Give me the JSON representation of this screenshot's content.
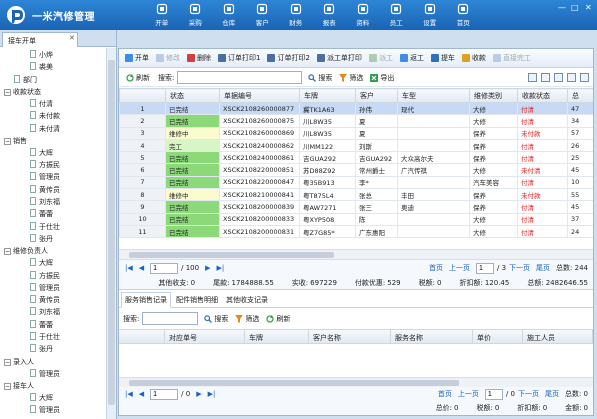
{
  "app": {
    "title": "一米汽修管理"
  },
  "nav": [
    {
      "label": "开单",
      "icon": "cart-icon"
    },
    {
      "label": "采购",
      "icon": "purchase-icon"
    },
    {
      "label": "仓库",
      "icon": "warehouse-icon"
    },
    {
      "label": "客户",
      "icon": "customer-icon"
    },
    {
      "label": "财务",
      "icon": "finance-icon"
    },
    {
      "label": "报表",
      "icon": "report-icon"
    },
    {
      "label": "资料",
      "icon": "data-icon"
    },
    {
      "label": "员工",
      "icon": "staff-icon"
    },
    {
      "label": "设置",
      "icon": "settings-icon"
    },
    {
      "label": "首页",
      "icon": "home-icon"
    }
  ],
  "window_controls": {
    "minimize": "—",
    "maximize": "□",
    "close": "✕"
  },
  "left_tab": {
    "label": "接车开单",
    "close": "✕"
  },
  "tree": [
    {
      "label": "小烨",
      "level": 2
    },
    {
      "label": "裘美",
      "level": 2
    },
    {
      "label": "部门",
      "level": 1,
      "leaf": true
    },
    {
      "label": "收款状态",
      "level": 0,
      "toggle": "⊟"
    },
    {
      "label": "付清",
      "level": 1
    },
    {
      "label": "未付款",
      "level": 1
    },
    {
      "label": "未付清",
      "level": 1
    },
    {
      "label": "销售",
      "level": 0,
      "toggle": "⊟"
    },
    {
      "label": "大辉",
      "level": 1
    },
    {
      "label": "方振民",
      "level": 1
    },
    {
      "label": "管理员",
      "level": 1
    },
    {
      "label": "黄传员",
      "level": 1
    },
    {
      "label": "刘东福",
      "level": 1
    },
    {
      "label": "蕾蕾",
      "level": 1
    },
    {
      "label": "于仕壮",
      "level": 1
    },
    {
      "label": "张丹",
      "level": 1
    },
    {
      "label": "维修负责人",
      "level": 0,
      "toggle": "⊟"
    },
    {
      "label": "大辉",
      "level": 1
    },
    {
      "label": "方振民",
      "level": 1
    },
    {
      "label": "管理员",
      "level": 1
    },
    {
      "label": "黄传员",
      "level": 1
    },
    {
      "label": "刘东福",
      "level": 1
    },
    {
      "label": "蕾蕾",
      "level": 1
    },
    {
      "label": "于仕壮",
      "level": 1
    },
    {
      "label": "张丹",
      "level": 1
    },
    {
      "label": "录入人",
      "level": 0,
      "toggle": "⊟"
    },
    {
      "label": "管理员",
      "level": 1
    },
    {
      "label": "接车人",
      "level": 0,
      "toggle": "⊟"
    },
    {
      "label": "大辉",
      "level": 1
    },
    {
      "label": "管理员",
      "level": 1
    }
  ],
  "toolbar": [
    {
      "label": "开单",
      "icon": "new-order-icon",
      "enabled": true,
      "color": "#3a8ee6"
    },
    {
      "label": "修改",
      "icon": "edit-icon",
      "enabled": false,
      "color": "#7a9cc6"
    },
    {
      "label": "删除",
      "icon": "delete-icon",
      "enabled": true,
      "color": "#d04040"
    },
    {
      "label": "订单打印1",
      "icon": "print-icon",
      "enabled": true,
      "color": "#4a6fa0"
    },
    {
      "label": "订单打印2",
      "icon": "print-icon",
      "enabled": true,
      "color": "#4a6fa0"
    },
    {
      "label": "派工单打印",
      "icon": "print-icon",
      "enabled": true,
      "color": "#4a6fa0"
    },
    {
      "label": "派工",
      "icon": "dispatch-icon",
      "enabled": false,
      "color": "#5c9c5c"
    },
    {
      "label": "返工",
      "icon": "rework-icon",
      "enabled": true,
      "color": "#3a8ee6"
    },
    {
      "label": "提车",
      "icon": "pickup-car-icon",
      "enabled": true,
      "color": "#2f6fbf"
    },
    {
      "label": "收款",
      "icon": "payment-icon",
      "enabled": true,
      "color": "#e0a020"
    },
    {
      "label": "直接完工",
      "icon": "complete-icon",
      "enabled": false,
      "color": "#7a9cc6"
    }
  ],
  "search": {
    "refresh": "刷新",
    "label": "搜索:",
    "button": "搜索",
    "filter": "筛选",
    "export": "导出"
  },
  "grid": {
    "columns": [
      "",
      "状态",
      "单据编号",
      "车牌",
      "客户",
      "车型",
      "维修类别",
      "收款状态",
      "总"
    ],
    "rows": [
      {
        "n": "1",
        "status": "已完结",
        "st": "done",
        "no": "XSCK2108260000877",
        "plate": "冀TK1A63",
        "cust": "孙伟",
        "model": "现代",
        "cat": "大修",
        "pay": "付清",
        "total": "47",
        "selected": true
      },
      {
        "n": "2",
        "status": "已完结",
        "st": "done",
        "no": "XSCK2108260000875",
        "plate": "川L8W35",
        "cust": "夏",
        "model": "",
        "cat": "大修",
        "pay": "付清",
        "total": "34"
      },
      {
        "n": "3",
        "status": "维修中",
        "st": "ing",
        "no": "XSCK2108260000869",
        "plate": "川L8W35",
        "cust": "夏",
        "model": "",
        "cat": "保养",
        "pay": "未付款",
        "total": "57"
      },
      {
        "n": "4",
        "status": "完工",
        "st": "fin",
        "no": "XSCK2108240000862",
        "plate": "川MM122",
        "cust": "刘斯",
        "model": "",
        "cat": "保养",
        "pay": "付清",
        "total": "26"
      },
      {
        "n": "5",
        "status": "已完结",
        "st": "done",
        "no": "XSCK2108240000861",
        "plate": "吉GUA292",
        "cust": "吉GUA292",
        "model": "大众高尔夫",
        "cat": "保养",
        "pay": "付清",
        "total": "25"
      },
      {
        "n": "6",
        "status": "已完结",
        "st": "done",
        "no": "XSCK2108220000851",
        "plate": "苏D88Z92",
        "cust": "常州爵士",
        "model": "广汽传祺",
        "cat": "大修",
        "pay": "未付清",
        "total": "45"
      },
      {
        "n": "7",
        "status": "已完结",
        "st": "done",
        "no": "XSCK2108220000847",
        "plate": "粤35B913",
        "cust": "李*",
        "model": "",
        "cat": "汽车美容",
        "pay": "付清",
        "total": "10"
      },
      {
        "n": "8",
        "status": "维修中",
        "st": "ing",
        "no": "XSCK2108210000841",
        "plate": "粤T875L4",
        "cust": "张总",
        "model": "丰田",
        "cat": "保养",
        "pay": "未付款",
        "total": "55"
      },
      {
        "n": "9",
        "status": "已完结",
        "st": "done",
        "no": "XSCK2108200000839",
        "plate": "粤AW7271",
        "cust": "张三",
        "model": "奥迪",
        "cat": "保养",
        "pay": "付清",
        "total": "45"
      },
      {
        "n": "10",
        "status": "已完结",
        "st": "done",
        "no": "XSCK2108200000833",
        "plate": "粤XYP508",
        "cust": "陈",
        "model": "",
        "cat": "大修",
        "pay": "付清",
        "total": "37"
      },
      {
        "n": "11",
        "status": "已完结",
        "st": "done",
        "no": "XSCK2108200000831",
        "plate": "粤Z7G85*",
        "cust": "广东惠阳",
        "model": "",
        "cat": "大修",
        "pay": "付清",
        "total": "24"
      }
    ]
  },
  "pager": {
    "page": "1",
    "of_pages": "/ 100",
    "home": "首页",
    "prev": "上一页",
    "right_page": "1",
    "right_of": "/ 3",
    "next": "下一页",
    "last": "尾页",
    "total": "总数: 244"
  },
  "summary": [
    {
      "label": "其他收支:",
      "value": "0"
    },
    {
      "label": "尾款:",
      "value": "1784888.55"
    },
    {
      "label": "实收:",
      "value": "697229"
    },
    {
      "label": "付款优惠:",
      "value": "529"
    },
    {
      "label": "税额:",
      "value": "0"
    },
    {
      "label": "折扣额:",
      "value": "120.45"
    },
    {
      "label": "总额:",
      "value": "2482646.55"
    }
  ],
  "subtabs": [
    "服务销售记录",
    "配件销售明细",
    "其他收支记录"
  ],
  "subgrid": {
    "columns": [
      "",
      "对应单号",
      "车牌",
      "客户名称",
      "服务名称",
      "单价",
      "施工人员"
    ]
  },
  "pager2": {
    "page": "1",
    "of_pages": "/ 0",
    "home": "首页",
    "prev": "上一页",
    "right_page": "1",
    "right_of": "/ 0",
    "next": "下一页",
    "last": "尾页",
    "total": "总数: 0"
  },
  "summary2": [
    {
      "label": "总价:",
      "value": "0"
    },
    {
      "label": "税额:",
      "value": "0"
    },
    {
      "label": "折扣额:",
      "value": "0"
    },
    {
      "label": "金额:",
      "value": "0"
    }
  ]
}
